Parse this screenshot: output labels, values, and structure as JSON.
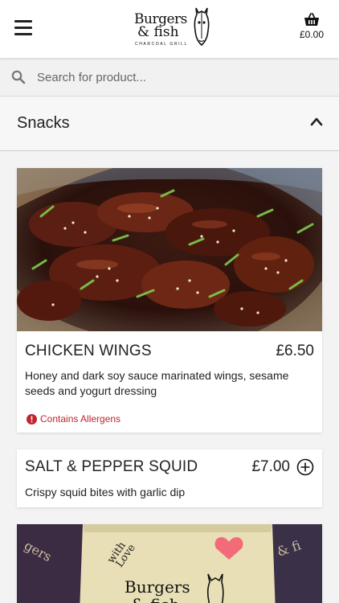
{
  "header": {
    "logo_line1": "Burgers",
    "logo_line2": "& fish",
    "logo_tagline": "CHARCOAL GRILL",
    "cart_total": "£0.00"
  },
  "search": {
    "placeholder": "Search for product..."
  },
  "category": {
    "title": "Snacks",
    "expanded": true
  },
  "products": [
    {
      "name": "CHICKEN WINGS",
      "price": "£6.50",
      "description": "Honey and dark soy sauce marinated wings, sesame seeds and yogurt dressing",
      "allergen_note": "Contains Allergens",
      "has_photo": true
    },
    {
      "name": "SALT & PEPPER SQUID",
      "price": "£7.00",
      "description": "Crispy squid bites with garlic dip",
      "has_photo": false
    },
    {
      "name": "",
      "has_photo": true,
      "photo_text_1": "with",
      "photo_text_2": "Love",
      "photo_logo": "Burgers",
      "photo_logo_2": "& fish"
    }
  ],
  "colors": {
    "allergen": "#c0242c",
    "text": "#222222",
    "background": "#f3f3f3"
  },
  "icons": {
    "menu": "hamburger-menu-icon",
    "cart": "basket-icon",
    "search": "search-icon",
    "collapse": "chevron-up-icon",
    "allergen": "exclamation-circle-icon",
    "add": "plus-circle-icon"
  }
}
